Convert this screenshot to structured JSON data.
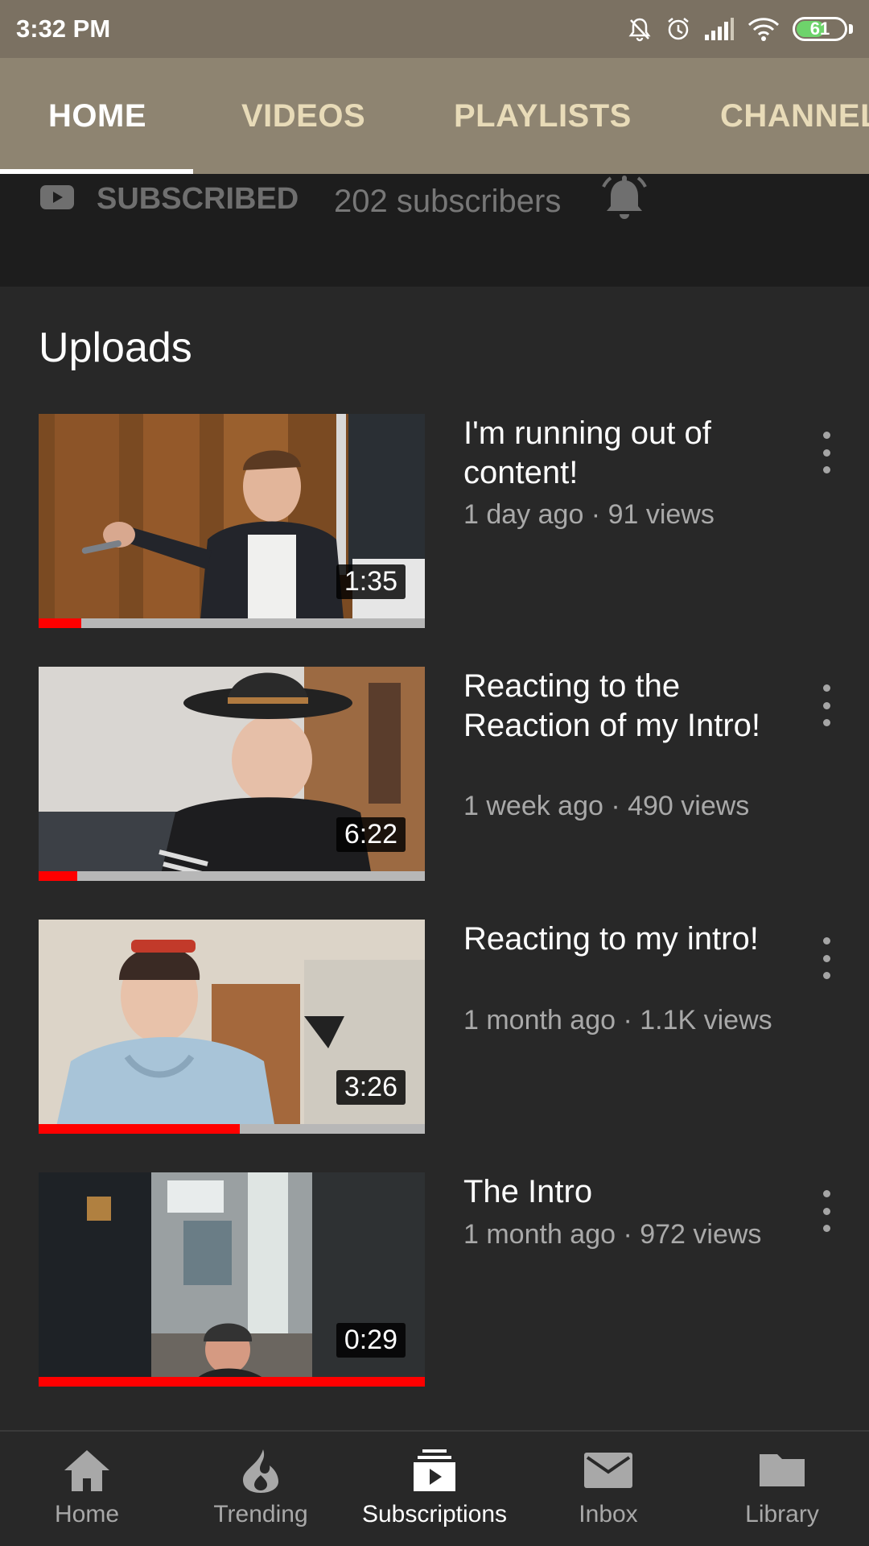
{
  "status_bar": {
    "time": "3:32 PM",
    "battery_level": "61",
    "icons": [
      "mute-bell-icon",
      "alarm-icon",
      "signal-icon",
      "wifi-icon",
      "battery-icon"
    ]
  },
  "tabs": [
    {
      "label": "HOME",
      "active": true
    },
    {
      "label": "VIDEOS",
      "active": false
    },
    {
      "label": "PLAYLISTS",
      "active": false
    },
    {
      "label": "CHANNEL",
      "active": false
    }
  ],
  "subscription": {
    "status_label": "SUBSCRIBED",
    "subscriber_count": "202 subscribers",
    "notifications_icon": "bell-icon"
  },
  "uploads": {
    "title": "Uploads",
    "videos": [
      {
        "title": "I'm running out of content!",
        "meta": "1 day ago · 91 views",
        "duration": "1:35",
        "watched_fraction": 0.11
      },
      {
        "title": "Reacting to the Reaction of my Intro!",
        "meta": "1 week ago · 490 views",
        "duration": "6:22",
        "watched_fraction": 0.1
      },
      {
        "title": "Reacting to my intro!",
        "meta": "1 month ago · 1.1K views",
        "duration": "3:26",
        "watched_fraction": 0.52
      },
      {
        "title": "The Intro",
        "meta": "1 month ago · 972 views",
        "duration": "0:29",
        "watched_fraction": 1.0
      }
    ]
  },
  "bottom_nav": [
    {
      "label": "Home",
      "icon": "home-icon",
      "active": false
    },
    {
      "label": "Trending",
      "icon": "flame-icon",
      "active": false
    },
    {
      "label": "Subscriptions",
      "icon": "subscriptions-icon",
      "active": true
    },
    {
      "label": "Inbox",
      "icon": "mail-icon",
      "active": false
    },
    {
      "label": "Library",
      "icon": "folder-icon",
      "active": false
    }
  ],
  "colors": {
    "accent": "#ff0000",
    "header": "#8e8471",
    "status_bar": "#7b7162",
    "background": "#282828"
  }
}
